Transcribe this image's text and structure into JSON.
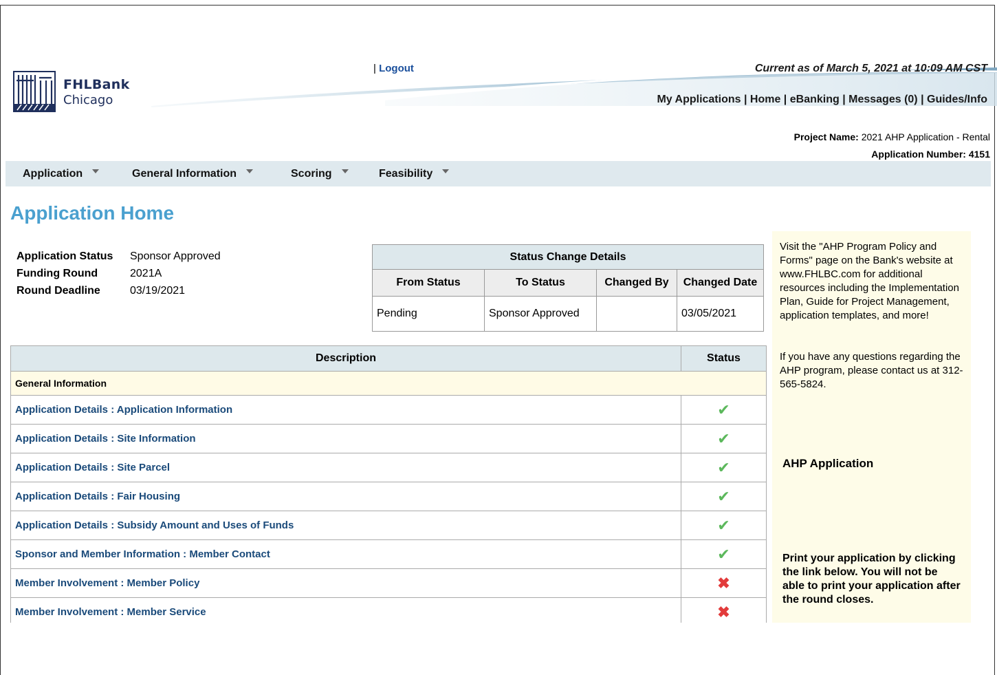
{
  "header": {
    "logo_line1": "FHLBank",
    "logo_line2": "Chicago",
    "logout_sep": "|",
    "logout": "Logout",
    "current": "Current as of March 5, 2021 at 10:09 AM CST",
    "topnav": [
      "My Applications",
      "Home",
      "eBanking",
      "Messages (0)",
      "Guides/Info"
    ],
    "project_name_label": "Project Name:",
    "project_name": "2021 AHP Application - Rental",
    "application_number_label": "Application Number:",
    "application_number": "4151"
  },
  "menu": [
    "Application",
    "General Information",
    "Scoring",
    "Feasibility"
  ],
  "page_title": "Application Home",
  "status_info": [
    {
      "label": "Application Status",
      "value": "Sponsor Approved"
    },
    {
      "label": "Funding Round",
      "value": "2021A"
    },
    {
      "label": "Round Deadline",
      "value": "03/19/2021"
    }
  ],
  "status_change": {
    "caption": "Status Change Details",
    "columns": [
      "From Status",
      "To Status",
      "Changed By",
      "Changed Date"
    ],
    "rows": [
      [
        "Pending",
        "Sponsor Approved",
        "",
        "03/05/2021"
      ]
    ]
  },
  "main_table": {
    "columns": [
      "Description",
      "Status"
    ],
    "section": "General Information",
    "rows": [
      {
        "desc": "Application Details : Application Information",
        "status": "✔",
        "ok": true
      },
      {
        "desc": "Application Details : Site Information",
        "status": "✔",
        "ok": true
      },
      {
        "desc": "Application Details : Site Parcel",
        "status": "✔",
        "ok": true
      },
      {
        "desc": "Application Details : Fair Housing",
        "status": "✔",
        "ok": true
      },
      {
        "desc": "Application Details : Subsidy Amount and Uses of Funds",
        "status": "✔",
        "ok": true
      },
      {
        "desc": "Sponsor and Member Information : Member Contact",
        "status": "✔",
        "ok": true
      },
      {
        "desc": "Member Involvement : Member Policy",
        "status": "✖",
        "ok": false
      },
      {
        "desc": "Member Involvement : Member Service",
        "status": "✖",
        "ok": false
      }
    ]
  },
  "side": {
    "p1": "Visit the \"AHP Program Policy and Forms\" page on the Bank's website at www.FHLBC.com for additional resources including the Implementation Plan, Guide for Project Management, application templates, and more!",
    "p2": "If you have any questions regarding the AHP program, please contact us at 312-565-5824.",
    "p3": "AHP Application",
    "p4": "Print your application by clicking the link below. You will not be able to print your application after the round closes."
  },
  "colors": {
    "title": "#4aa0cf",
    "link": "#1a4a7a",
    "check": "#5cb85c",
    "cross": "#e23b3b"
  }
}
